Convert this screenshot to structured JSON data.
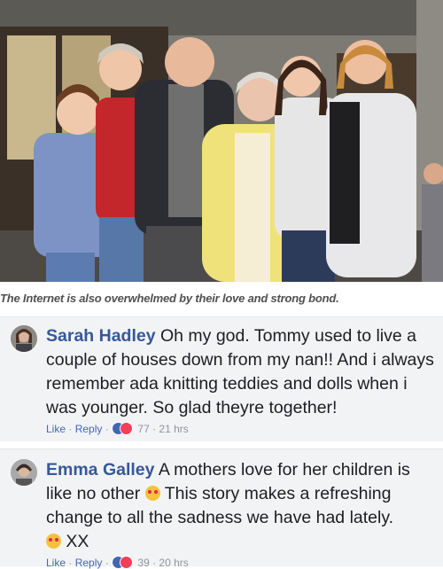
{
  "caption": "The Internet is also overwhelmed by their love and strong bond.",
  "comments": [
    {
      "author": "Sarah Hadley",
      "text": "Oh my god. Tommy used to live a couple of houses down from my nan!! And i always remember ada knitting teddies and dolls when i was younger. So glad theyre together!",
      "like_label": "Like",
      "reply_label": "Reply",
      "reaction_count": "77",
      "time": "21 hrs"
    },
    {
      "author": "Emma Galley",
      "text_part1": "A mothers love for her children is like no other",
      "text_part2": "This story makes a refreshing change to all the sadness we have had lately.",
      "text_part3": "XX",
      "like_label": "Like",
      "reply_label": "Reply",
      "reaction_count": "39",
      "time": "20 hrs"
    }
  ],
  "colors": {
    "name_link": "#365899",
    "action_link": "#4267b2",
    "meta_text": "#90949c",
    "comment_bg": "#f2f3f5"
  },
  "icons": [
    "heart-eyes-emoji-icon",
    "kiss-emoji-icon",
    "like-reaction-icon",
    "love-reaction-icon"
  ]
}
